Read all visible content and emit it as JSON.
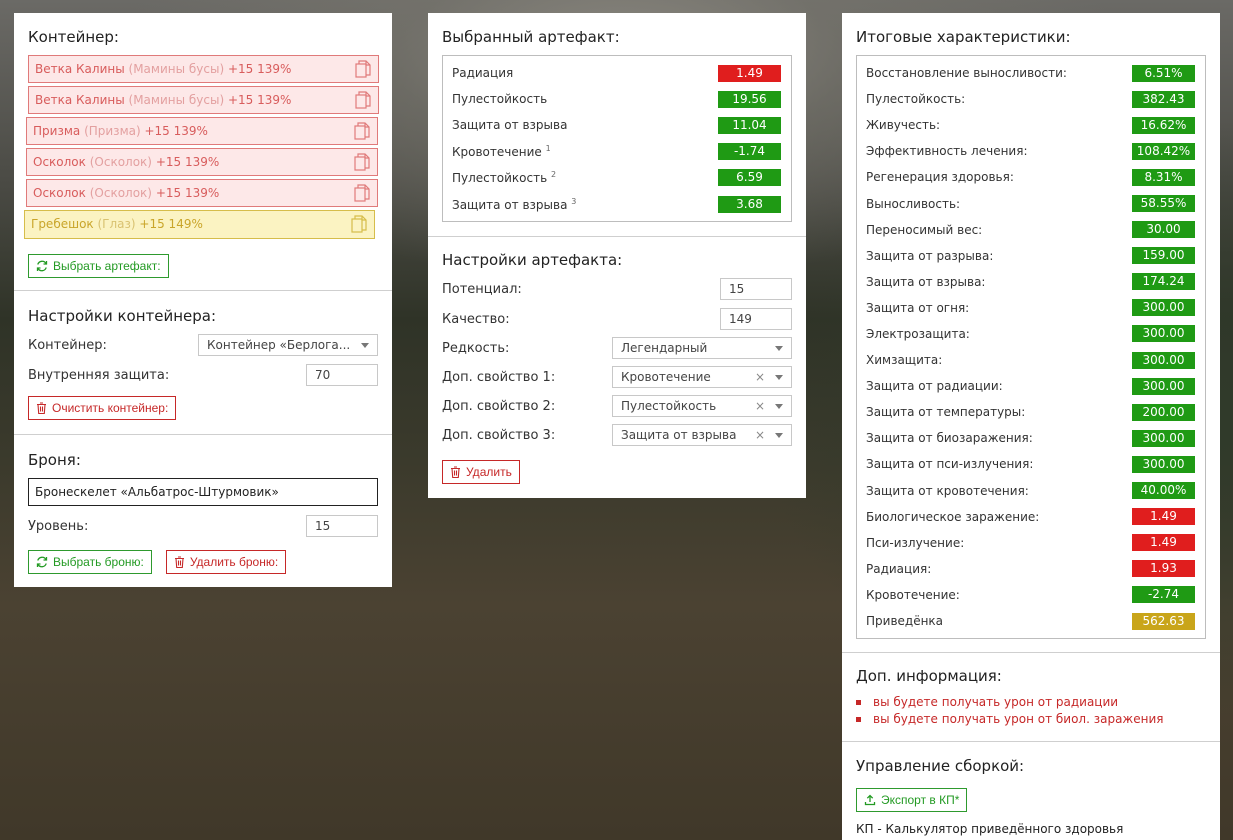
{
  "container_panel": {
    "title": "Контейнер:",
    "artifacts": [
      {
        "name": "Ветка Калины",
        "type": "(Мамины бусы)",
        "suffix": "+15 139%",
        "rarity": "red"
      },
      {
        "name": "Ветка Калины",
        "type": "(Мамины бусы)",
        "suffix": "+15 139%",
        "rarity": "red"
      },
      {
        "name": "Призма",
        "type": "(Призма)",
        "suffix": "+15 139%",
        "rarity": "red"
      },
      {
        "name": "Осколок",
        "type": "(Осколок)",
        "suffix": "+15 139%",
        "rarity": "red"
      },
      {
        "name": "Осколок",
        "type": "(Осколок)",
        "suffix": "+15 139%",
        "rarity": "red"
      },
      {
        "name": "Гребешок",
        "type": "(Глаз)",
        "suffix": "+15 149%",
        "rarity": "gold"
      }
    ],
    "select_artifact_label": "Выбрать артефакт:",
    "settings_title": "Настройки контейнера:",
    "container_label": "Контейнер:",
    "container_value": "Контейнер «Берлога...",
    "inner_protection_label": "Внутренняя защита:",
    "inner_protection_value": "70",
    "clear_label": "Очистить контейнер:",
    "armor_title": "Броня:",
    "armor_value": "Бронескелет «Альбатрос-Штурмовик»",
    "level_label": "Уровень:",
    "level_value": "15",
    "select_armor_label": "Выбрать броню:",
    "delete_armor_label": "Удалить броню:"
  },
  "artifact_panel": {
    "title": "Выбранный артефакт:",
    "stats": [
      {
        "label": "Радиация",
        "sup": "",
        "value": "1.49",
        "color": "red"
      },
      {
        "label": "Пулестойкость",
        "sup": "",
        "value": "19.56",
        "color": "green"
      },
      {
        "label": "Защита от взрыва",
        "sup": "",
        "value": "11.04",
        "color": "green"
      },
      {
        "label": "Кровотечение",
        "sup": "1",
        "value": "-1.74",
        "color": "green"
      },
      {
        "label": "Пулестойкость",
        "sup": "2",
        "value": "6.59",
        "color": "green"
      },
      {
        "label": "Защита от взрыва",
        "sup": "3",
        "value": "3.68",
        "color": "green"
      }
    ],
    "settings_title": "Настройки артефакта:",
    "potential_label": "Потенциал:",
    "potential_value": "15",
    "quality_label": "Качество:",
    "quality_value": "149",
    "rarity_label": "Редкость:",
    "rarity_value": "Легендарный",
    "extra1_label": "Доп. свойство 1:",
    "extra1_value": "Кровотечение",
    "extra2_label": "Доп. свойство 2:",
    "extra2_value": "Пулестойкость",
    "extra3_label": "Доп. свойство 3:",
    "extra3_value": "Защита от взрыва",
    "delete_label": "Удалить"
  },
  "totals_panel": {
    "title": "Итоговые характеристики:",
    "stats": [
      {
        "label": "Восстановление выносливости:",
        "value": "6.51%",
        "color": "green"
      },
      {
        "label": "Пулестойкость:",
        "value": "382.43",
        "color": "green"
      },
      {
        "label": "Живучесть:",
        "value": "16.62%",
        "color": "green"
      },
      {
        "label": "Эффективность лечения:",
        "value": "108.42%",
        "color": "green"
      },
      {
        "label": "Регенерация здоровья:",
        "value": "8.31%",
        "color": "green"
      },
      {
        "label": "Выносливость:",
        "value": "58.55%",
        "color": "green"
      },
      {
        "label": "Переносимый вес:",
        "value": "30.00",
        "color": "green"
      },
      {
        "label": "Защита от разрыва:",
        "value": "159.00",
        "color": "green"
      },
      {
        "label": "Защита от взрыва:",
        "value": "174.24",
        "color": "green"
      },
      {
        "label": "Защита от огня:",
        "value": "300.00",
        "color": "green"
      },
      {
        "label": "Электрозащита:",
        "value": "300.00",
        "color": "green"
      },
      {
        "label": "Химзащита:",
        "value": "300.00",
        "color": "green"
      },
      {
        "label": "Защита от радиации:",
        "value": "300.00",
        "color": "green"
      },
      {
        "label": "Защита от температуры:",
        "value": "200.00",
        "color": "green"
      },
      {
        "label": "Защита от биозаражения:",
        "value": "300.00",
        "color": "green"
      },
      {
        "label": "Защита от пси-излучения:",
        "value": "300.00",
        "color": "green"
      },
      {
        "label": "Защита от кровотечения:",
        "value": "40.00%",
        "color": "green"
      },
      {
        "label": "Биологическое заражение:",
        "value": "1.49",
        "color": "red"
      },
      {
        "label": "Пси-излучение:",
        "value": "1.49",
        "color": "red"
      },
      {
        "label": "Радиация:",
        "value": "1.93",
        "color": "red"
      },
      {
        "label": "Кровотечение:",
        "value": "-2.74",
        "color": "green"
      },
      {
        "label": "Приведёнка",
        "value": "562.63",
        "color": "gold"
      }
    ],
    "info_title": "Доп. информация:",
    "info_items": [
      "вы будете получать урон от радиации",
      "вы будете получать урон от биол. заражения"
    ],
    "build_title": "Управление сборкой:",
    "export_label": "Экспорт в КП*",
    "footnote": "КП - Калькулятор приведённого здоровья"
  },
  "colors": {
    "red": "#e01e1e",
    "green": "#1f9a14",
    "gold": "#c9a51a",
    "accent_green": "#239a23",
    "accent_red": "#c62828"
  }
}
